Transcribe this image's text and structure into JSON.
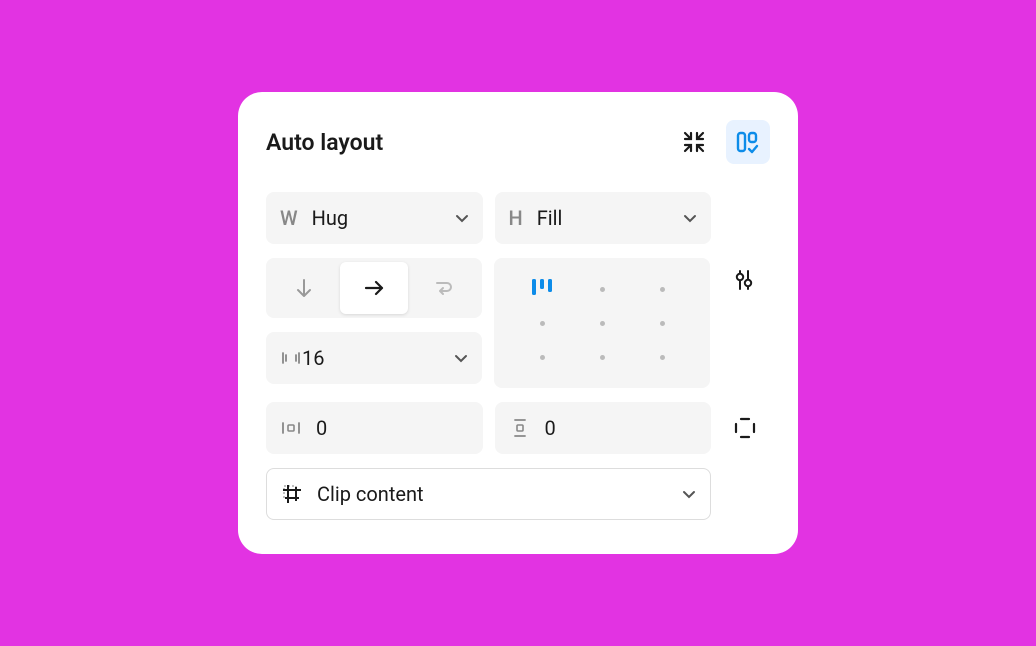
{
  "title": "Auto layout",
  "width": {
    "prefix": "W",
    "value": "Hug"
  },
  "height": {
    "prefix": "H",
    "value": "Fill"
  },
  "direction": {
    "selected": "horizontal"
  },
  "gap": {
    "value": "16"
  },
  "paddingH": {
    "value": "0"
  },
  "paddingV": {
    "value": "0"
  },
  "clip": {
    "value": "Clip content"
  },
  "alignment": {
    "selected": "top-left"
  }
}
